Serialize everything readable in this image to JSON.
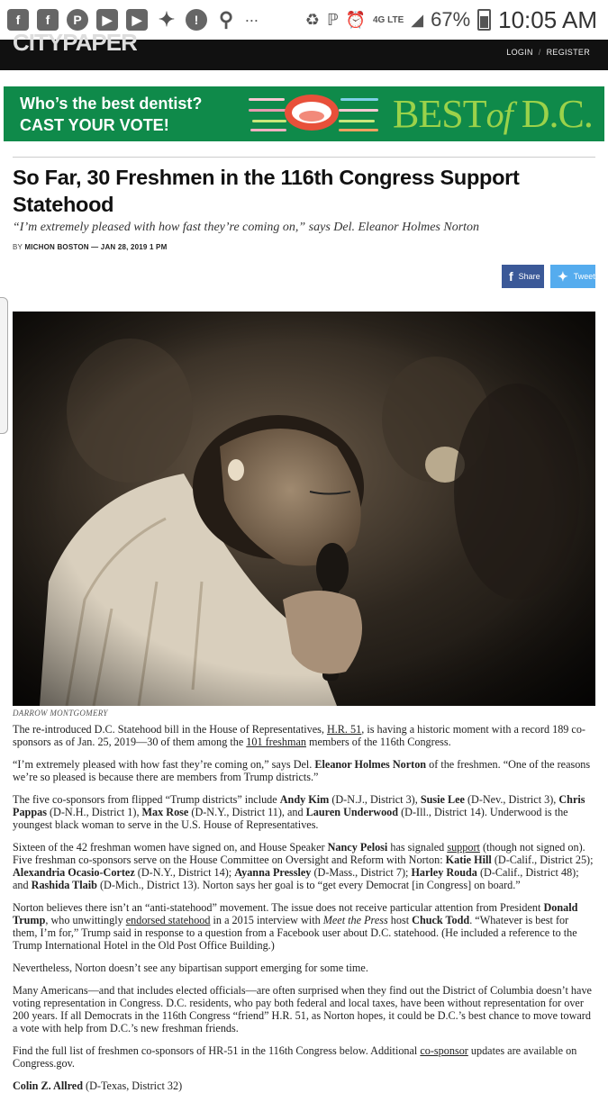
{
  "statusbar": {
    "notification_icons": [
      "facebook-icon",
      "facebook-icon",
      "pinterest-icon",
      "youtube-icon",
      "youtube-icon",
      "twitter-icon",
      "alert-icon",
      "location-icon"
    ],
    "more": "∙∙∙",
    "network": "4G LTE",
    "battery": "67%",
    "time": "10:05 AM"
  },
  "header": {
    "logo": "CITYPAPER",
    "login": "LOGIN",
    "sep": "/",
    "register": "REGISTER"
  },
  "banner": {
    "line1": "Who’s the best dentist?",
    "line2": "CAST YOUR VOTE!",
    "brand_prefix": "BEST",
    "brand_of": "of",
    "brand_suffix": "D.C.",
    "bg_color": "#0f8a4a",
    "brand_color": "#9bd24a"
  },
  "article": {
    "title": "So Far, 30 Freshmen in the 116th Congress Support Statehood",
    "dek": "“I’m extremely pleased with how fast they’re coming on,” says Del. Eleanor Holmes Norton",
    "byline_prefix": "BY",
    "author": "MICHON BOSTON",
    "byline_sep": "—",
    "date": "JAN 28, 2019 1 PM",
    "share_fb": "Share",
    "share_tw": "Tweet",
    "photo_credit": "DARROW MONTGOMERY",
    "p1": {
      "a": "The re-introduced D.C. Statehood bill in the House of Representatives, ",
      "link1": "H.R. 51",
      "b": ", is having a historic moment with a record 189 co-sponsors as of Jan. 25, 2019—30 of them among the ",
      "link2": "101 freshman",
      "c": " members of the 116th Congress."
    },
    "p2": {
      "a": "“I’m extremely pleased with how fast they’re coming on,” says Del. ",
      "name": "Eleanor Holmes Norton",
      "b": " of the freshmen. “One of the reasons we’re so pleased is because there are members from Trump districts.”"
    },
    "p3": {
      "a": "The five co-sponsors from flipped “Trump districts” include ",
      "n1": "Andy Kim",
      "b": " (D-N.J., District 3), ",
      "n2": "Susie Lee",
      "c": " (D-Nev., District 3), ",
      "n3": "Chris Pappas",
      "d": " (D-N.H., District 1), ",
      "n4": "Max Rose",
      "e": " (D-N.Y., District 11), and ",
      "n5": "Lauren Underwood",
      "f": " (D-Ill., District 14). Underwood is the youngest black woman to serve in the U.S. House of Representatives."
    },
    "p4": {
      "a": "Sixteen of the 42 freshman women have signed on, and House Speaker ",
      "n1": "Nancy Pelosi",
      "b": " has signaled ",
      "link": "support",
      "c": " (though not signed on). Five freshman co-sponsors serve on the House Committee on Oversight and Reform with Norton: ",
      "n2": "Katie Hill",
      "d": " (D-Calif., District 25); ",
      "n3": "Alexandria Ocasio-Cortez",
      "e": " (D-N.Y., District 14); ",
      "n4": "Ayanna Pressley",
      "f": " (D-Mass., District 7); ",
      "n5": "Harley Rouda",
      "g": " (D-Calif., District 48); and ",
      "n6": "Rashida Tlaib",
      "h": " (D-Mich., District 13). Norton says her goal is to “get every Democrat [in Congress] on board.”"
    },
    "p5": {
      "a": "Norton believes there isn’t an “anti-statehood” movement. The issue does not receive particular attention from President ",
      "n1": "Donald Trump",
      "b": ", who unwittingly ",
      "link": "endorsed statehood",
      "c": " in a 2015 interview with ",
      "show": "Meet the Press",
      "d": " host ",
      "n2": "Chuck Todd",
      "e": ". “Whatever is best for them, I’m for,” Trump said in response to a question from a Facebook user about D.C. statehood. (He included a reference to the Trump International Hotel in the Old Post Office Building.)"
    },
    "p6": "Nevertheless, Norton doesn’t see any bipartisan support emerging for some time.",
    "p7": "Many Americans—and that includes elected officials—are often surprised when they find out the District of Columbia doesn’t have voting representation in Congress. D.C. residents, who pay both federal and local taxes, have been without representation for over 200 years. If all Democrats in the 116th Congress “friend” H.R. 51, as Norton hopes, it could be D.C.’s best chance to move toward a vote with help from D.C.’s new freshman friends.",
    "p8": {
      "a": "Find the full list of freshmen co-sponsors of HR-51 in the 116th Congress below. Additional ",
      "link": "co-sponsor",
      "b": " updates are available on Congress.gov."
    },
    "p9": {
      "n1": "Colin Z. Allred",
      "a": " (D-Texas, District 32)"
    }
  }
}
